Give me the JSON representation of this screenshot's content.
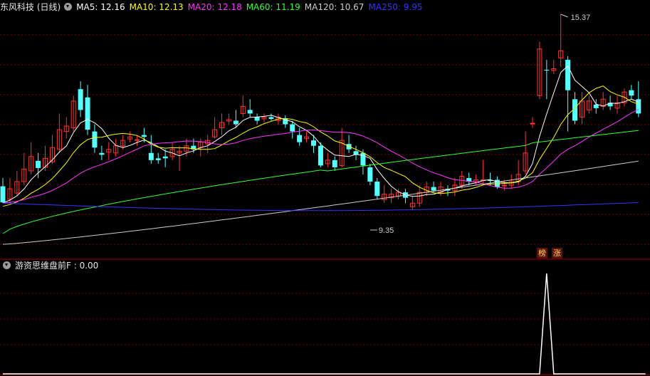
{
  "header": {
    "title": "东风科技 (日线)",
    "ma_items": [
      {
        "label": "MA5: 12.16",
        "color": "#ffffff"
      },
      {
        "label": "MA10: 12.13",
        "color": "#ffff00"
      },
      {
        "label": "MA20: 12.18",
        "color": "#ff33ff"
      },
      {
        "label": "MA60: 11.19",
        "color": "#33ff33"
      },
      {
        "label": "MA120: 10.67",
        "color": "#cccccc"
      },
      {
        "label": "MA250: 9.95",
        "color": "#3333ff"
      }
    ]
  },
  "indicator": {
    "title": "游资思维盘前F : 0.00"
  },
  "badges": {
    "first": "榜",
    "second": "涨"
  },
  "colors": {
    "up": "#ff3232",
    "down": "#54ffff",
    "grid": "#7a0000",
    "ma5": "#ffffff",
    "ma10": "#ffff00",
    "ma20": "#ff33ff",
    "ma60": "#33ff33",
    "ma120": "#cccccc",
    "ma250": "#3333ff"
  },
  "chart_data": {
    "type": "candlestick",
    "annotations": {
      "high": "15.37",
      "low": "9.35"
    },
    "indicator_series": [
      0,
      0,
      0,
      0,
      0,
      0,
      0,
      0,
      0,
      0,
      0,
      0,
      0,
      0,
      0,
      0,
      0,
      0,
      0,
      0,
      0,
      0,
      0,
      0,
      0,
      0,
      0,
      0,
      0,
      0,
      0,
      0,
      0,
      0,
      0,
      0,
      0,
      0,
      0,
      0,
      0,
      0,
      0,
      0,
      0,
      0,
      0,
      0,
      0,
      0,
      0,
      0,
      0,
      0,
      0,
      0,
      0,
      0,
      0,
      0,
      0,
      0,
      0,
      0,
      0,
      0,
      0,
      0,
      0,
      0,
      0,
      0,
      0,
      0,
      0,
      0,
      0,
      1,
      0,
      0,
      0,
      0,
      0,
      0,
      0,
      0,
      0,
      0,
      0,
      0,
      0,
      0
    ]
  }
}
